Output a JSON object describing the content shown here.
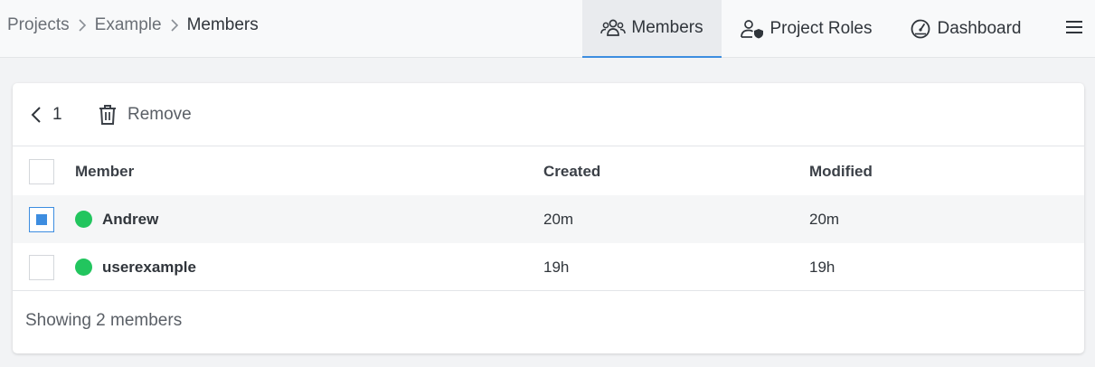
{
  "breadcrumb": {
    "items": [
      "Projects",
      "Example"
    ],
    "current": "Members"
  },
  "nav": {
    "tabs": [
      {
        "label": "Members",
        "icon": "users-icon",
        "active": true
      },
      {
        "label": "Project Roles",
        "icon": "user-shield-icon",
        "active": false
      },
      {
        "label": "Dashboard",
        "icon": "gauge-icon",
        "active": false
      }
    ],
    "menu_icon": "hamburger-menu-icon"
  },
  "toolbar": {
    "page": "1",
    "remove_label": "Remove"
  },
  "table": {
    "columns": [
      "Member",
      "Created",
      "Modified"
    ],
    "rows": [
      {
        "name": "Andrew",
        "created": "20m",
        "modified": "20m",
        "selected": true,
        "status_color": "#22c55e"
      },
      {
        "name": "userexample",
        "created": "19h",
        "modified": "19h",
        "selected": false,
        "status_color": "#22c55e"
      }
    ]
  },
  "footer": {
    "text": "Showing 2 members"
  },
  "colors": {
    "accent": "#3d8de0",
    "online": "#22c55e"
  }
}
